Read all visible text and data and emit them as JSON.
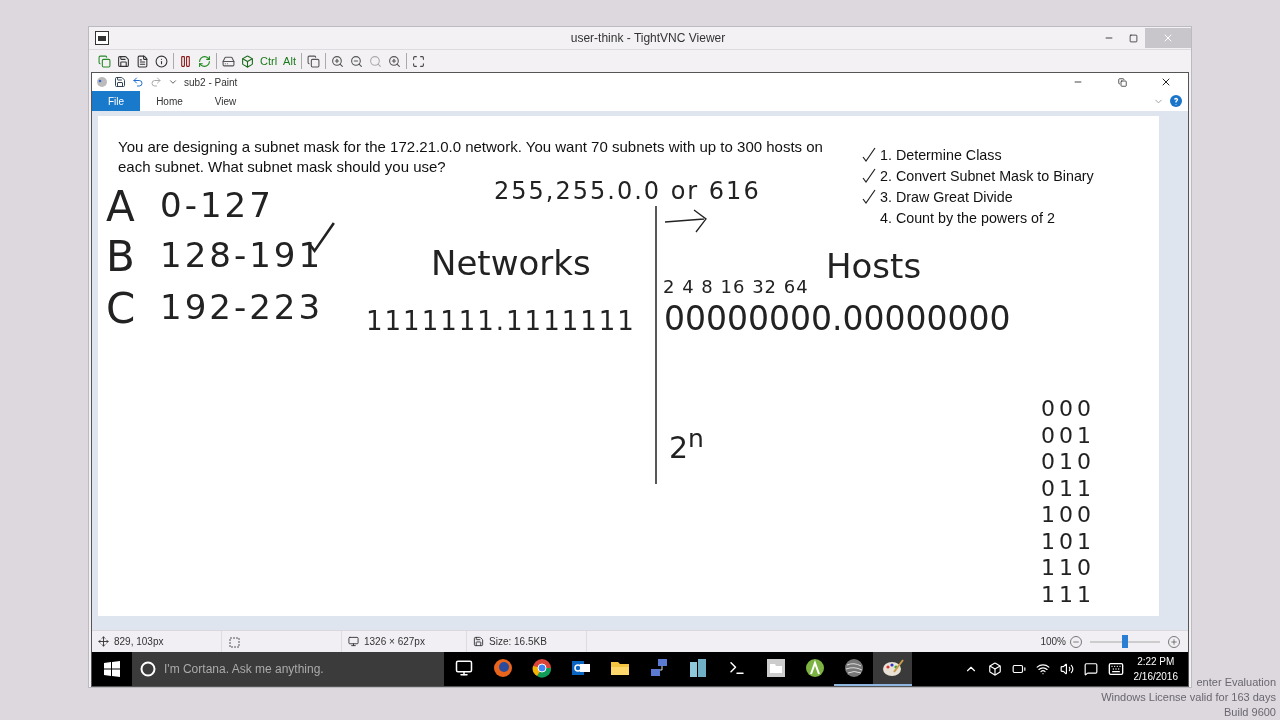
{
  "vnc_window": {
    "title": "user-think - TightVNC Viewer",
    "keys": [
      "Ctrl",
      "Alt"
    ]
  },
  "paint": {
    "title": "sub2 - Paint",
    "tabs": [
      {
        "label": "File",
        "selected": true
      },
      {
        "label": "Home",
        "selected": false
      },
      {
        "label": "View",
        "selected": false
      }
    ],
    "canvas": {
      "question": "You are designing a subnet mask for the 172.21.0.0 network. You want 70 subnets with up to 300 hosts on each subnet. What subnet mask should you use?",
      "steps": [
        {
          "text": "1. Determine Class",
          "checked": true
        },
        {
          "text": "2. Convert Subnet Mask to Binary",
          "checked": true
        },
        {
          "text": "3. Draw Great Divide",
          "checked": true
        },
        {
          "text": "4. Count by the powers of 2",
          "checked": false
        }
      ],
      "notes": {
        "mask": "255,255.0.0 or 616",
        "classes": [
          {
            "letter": "A",
            "range": "0-127",
            "checked": false
          },
          {
            "letter": "B",
            "range": "128-191",
            "checked": true
          },
          {
            "letter": "C",
            "range": "192-223",
            "checked": false
          }
        ],
        "networks": "Networks",
        "hosts": "Hosts",
        "powers": "2 4 8 16 32 64",
        "network_bits": "1111111.1111111",
        "host_bits": "00000000.00000000",
        "exponent": "2$^{n}$",
        "binary": [
          "000",
          "001",
          "010",
          "011",
          "100",
          "101",
          "110",
          "111"
        ]
      }
    },
    "status_bar": {
      "cursor": "829, 103px",
      "dimensions": "1326 × 627px",
      "size": "Size: 16.5KB",
      "zoom": "100%",
      "zoom_slider": {
        "level": 0.5
      }
    }
  },
  "taskbar": {
    "search_placeholder": "I'm Cortana. Ask me anything.",
    "apps": [
      {
        "kind": "taskview",
        "running": false,
        "selected": false
      },
      {
        "kind": "firefox",
        "running": false,
        "selected": false
      },
      {
        "kind": "chrome",
        "running": false,
        "selected": false
      },
      {
        "kind": "outlook",
        "running": false,
        "selected": false
      },
      {
        "kind": "explorer",
        "running": false,
        "selected": false
      },
      {
        "kind": "network",
        "running": false,
        "selected": false
      },
      {
        "kind": "buildings",
        "running": false,
        "selected": false
      },
      {
        "kind": "terminal",
        "running": false,
        "selected": false
      },
      {
        "kind": "folderapp",
        "running": false,
        "selected": false
      },
      {
        "kind": "android",
        "running": false,
        "selected": false
      },
      {
        "kind": "sphere",
        "running": true,
        "selected": false
      },
      {
        "kind": "paint",
        "running": true,
        "selected": true
      }
    ],
    "time": "2:22 PM",
    "date": "2/16/2016"
  },
  "watermark": [
    "enter Evaluation",
    "Windows License valid for 163 days",
    "Build 9600"
  ]
}
